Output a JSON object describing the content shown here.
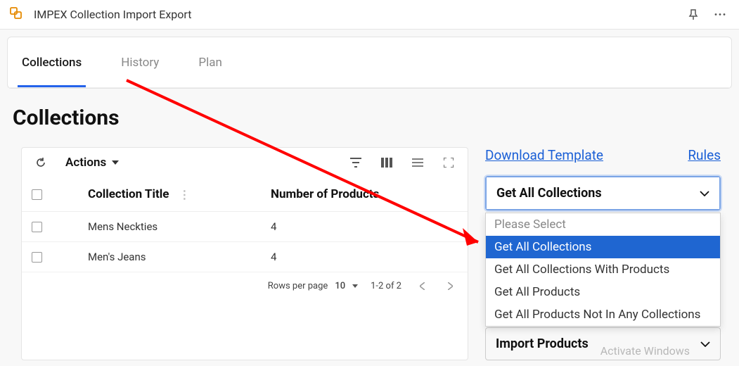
{
  "app": {
    "title": "IMPEX Collection Import Export"
  },
  "tabs": [
    "Collections",
    "History",
    "Plan"
  ],
  "page": {
    "heading": "Collections"
  },
  "toolbar": {
    "actions_label": "Actions"
  },
  "table": {
    "columns": {
      "title": "Collection Title",
      "num": "Number of Products"
    },
    "rows": [
      {
        "title": "Mens Neckties",
        "num": "4"
      },
      {
        "title": "Men's Jeans",
        "num": "4"
      }
    ],
    "footer": {
      "rpp_label": "Rows per page",
      "rpp_value": "10",
      "range": "1-2 of 2"
    }
  },
  "links": {
    "download": "Download Template",
    "rules": "Rules"
  },
  "export_select": {
    "value": "Get All Collections",
    "options": [
      "Please Select",
      "Get All Collections",
      "Get All Collections With Products",
      "Get All Products",
      "Get All Products Not In Any Collections"
    ]
  },
  "import": {
    "title": "Import Products"
  },
  "watermark": "Activate Windows"
}
